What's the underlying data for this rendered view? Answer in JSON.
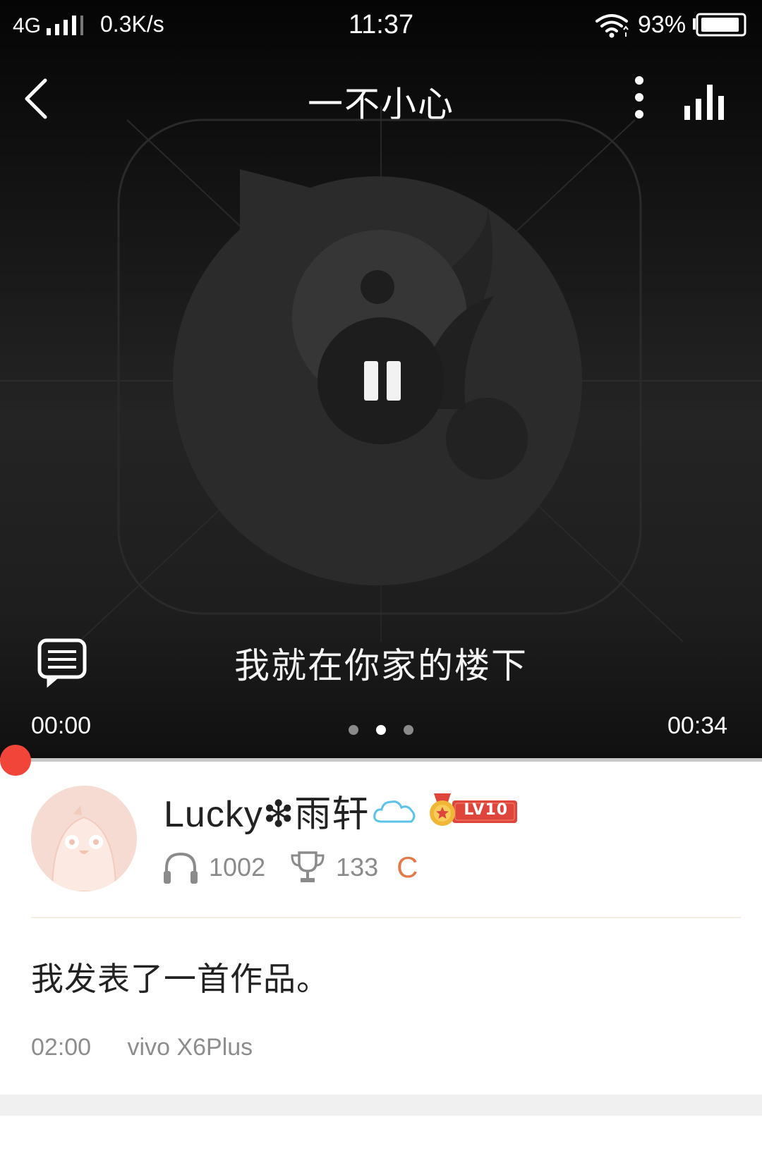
{
  "status_bar": {
    "network": "4G",
    "speed": "0.3K/s",
    "time": "11:37",
    "battery_percent": "93%",
    "battery_level": 0.93
  },
  "nav": {
    "title": "一不小心",
    "icons": [
      "back-arrow-icon",
      "more-vertical-icon",
      "stats-bars-icon"
    ]
  },
  "player": {
    "lyric": "我就在你家的楼下",
    "current_time": "00:00",
    "total_time": "00:34",
    "progress": 0.0,
    "state": "playing",
    "page_dots": {
      "count": 3,
      "active_index": 1
    }
  },
  "post": {
    "username": "Lucky❇雨轩",
    "level": "LV10",
    "listen_count": "1002",
    "trophy_count": "133",
    "c_badge": "C",
    "text": "我发表了一首作品。",
    "time": "02:00",
    "device": "vivo X6Plus"
  },
  "colors": {
    "accent_red": "#f04538",
    "badge_red": "#e0453c",
    "badge_gold": "#f2b637",
    "c_badge_orange": "#e6794a",
    "meta_gray": "#8d8d8d"
  }
}
